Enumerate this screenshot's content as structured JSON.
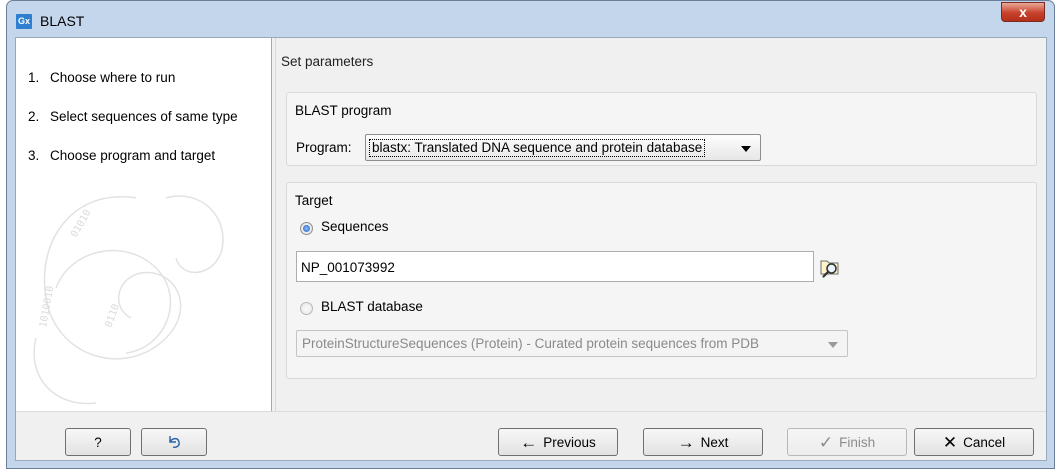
{
  "window": {
    "title": "BLAST",
    "app_icon": "Gx",
    "close_icon": "x"
  },
  "steps": [
    {
      "num": "1.",
      "label": "Choose where to run"
    },
    {
      "num": "2.",
      "label": "Select sequences of same type"
    },
    {
      "num": "3.",
      "label": "Choose program and target"
    }
  ],
  "page": {
    "title": "Set parameters"
  },
  "blast_program": {
    "group_label": "BLAST program",
    "program_label": "Program:",
    "program_value": "blastx: Translated DNA sequence and protein database"
  },
  "target": {
    "group_label": "Target",
    "sequences_option": "Sequences",
    "sequences_selected": true,
    "sequence_value": "NP_001073992",
    "database_option": "BLAST database",
    "database_selected": false,
    "database_value": "ProteinStructureSequences (Protein) - Curated protein sequences from PDB"
  },
  "buttons": {
    "help": "?",
    "reset_icon": "undo-arrow-icon",
    "previous": "Previous",
    "next": "Next",
    "finish": "Finish",
    "cancel": "Cancel",
    "previous_icon": "←",
    "next_icon": "→",
    "finish_icon": "✓",
    "cancel_icon": "✕"
  }
}
